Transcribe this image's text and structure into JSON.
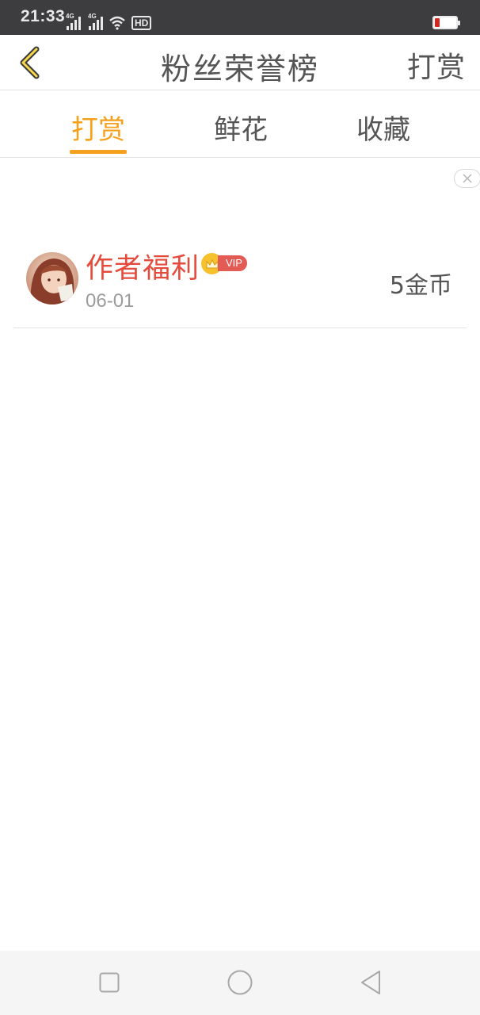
{
  "status_bar": {
    "time": "21:33",
    "network_1": "4G",
    "network_2": "4G",
    "hd_label": "HD",
    "battery_color": "#d6261c"
  },
  "header": {
    "back_icon": "chevron-left-icon",
    "title": "粉丝荣誉榜",
    "action_label": "打赏"
  },
  "tabs": [
    {
      "label": "打赏",
      "active": true
    },
    {
      "label": "鲜花",
      "active": false
    },
    {
      "label": "收藏",
      "active": false
    }
  ],
  "accent_color": "#f5a11d",
  "list": [
    {
      "name": "作者福利",
      "name_color": "#e54b3c",
      "badge_icon": "crown-icon",
      "vip_label": "VIP",
      "date": "06-01",
      "amount": "5金币"
    }
  ],
  "nav_bar": {
    "recent_icon": "square-icon",
    "home_icon": "circle-icon",
    "back_icon": "triangle-back-icon"
  }
}
